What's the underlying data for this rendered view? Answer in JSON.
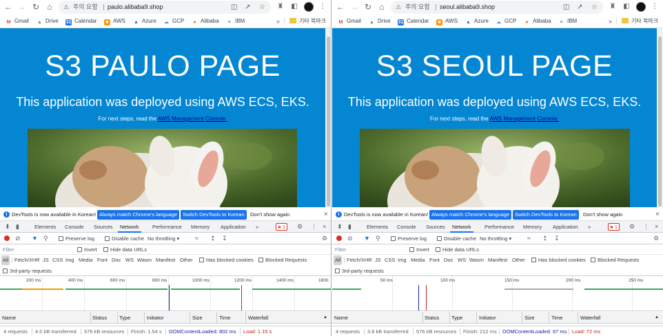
{
  "windows": [
    {
      "omnibox": {
        "security_label": "주의 요함",
        "url": "paulo.alibaba9.shop"
      },
      "page": {
        "title": "S3 PAULO PAGE",
        "subtitle": "This application was deployed using AWS ECS, EKS.",
        "next_prefix": "For next steps, read the ",
        "next_link": "AWS Management Console."
      },
      "timeline": {
        "ticks": [
          "200 ms",
          "400 ms",
          "600 ms",
          "800 ms",
          "1000 ms",
          "1200 ms",
          "1400 ms",
          "1600"
        ]
      },
      "status": {
        "requests": "4 requests",
        "transferred": "4.0 kB transferred",
        "resources": "576 kB resources",
        "finish": "Finish: 1.54 s",
        "dcl": "DOMContentLoaded: 802 ms",
        "load": "Load: 1.15 s"
      }
    },
    {
      "omnibox": {
        "security_label": "주의 요함",
        "url": "seoul.alibaba9.shop"
      },
      "page": {
        "title": "S3 SEOUL PAGE",
        "subtitle": "This application was deployed using AWS ECS, EKS.",
        "next_prefix": "For next steps, read the ",
        "next_link": "AWS Management Console."
      },
      "timeline": {
        "ticks": [
          "50 ms",
          "100 ms",
          "150 ms",
          "200 ms",
          "250 ms"
        ]
      },
      "status": {
        "requests": "4 requests",
        "transferred": "3.8 kB transferred",
        "resources": "576 kB resources",
        "finish": "Finish: 212 ms",
        "dcl": "DOMContentLoaded: 67 ms",
        "load": "Load: 72 ms"
      }
    }
  ],
  "bookmarks": [
    {
      "label": "Gmail",
      "icon": "gmail-icon",
      "color": "#ea4335"
    },
    {
      "label": "Drive",
      "icon": "drive-icon",
      "color": "#34a853"
    },
    {
      "label": "Calendar",
      "icon": "calendar-icon",
      "color": "#1a73e8"
    },
    {
      "label": "AWS",
      "icon": "aws-icon",
      "color": "#ff9900"
    },
    {
      "label": "Azure",
      "icon": "azure-icon",
      "color": "#0078d4"
    },
    {
      "label": "GCP",
      "icon": "gcp-icon",
      "color": "#4285f4"
    },
    {
      "label": "Alibaba",
      "icon": "alibaba-icon",
      "color": "#ff6a00"
    },
    {
      "label": "IBM",
      "icon": "ibm-icon",
      "color": "#1f70c1"
    }
  ],
  "bookmarks_more": "»",
  "other_bookmarks": "기타 북마크",
  "infobar": {
    "message": "DevTools is now available in Korean!",
    "btn_match": "Always match Chrome's language",
    "btn_switch": "Switch DevTools to Korean",
    "dont_show": "Don't show again"
  },
  "devtools_tabs": [
    "Elements",
    "Console",
    "Sources",
    "Network",
    "Performance",
    "Memory",
    "Application"
  ],
  "devtools_active_tab": "Network",
  "devtools_more": "»",
  "error_count": "1",
  "network_toolbar": {
    "preserve_log": "Preserve log",
    "disable_cache": "Disable cache",
    "throttling": "No throttling"
  },
  "filter": {
    "placeholder": "Filter",
    "invert": "Invert",
    "hide_data_urls": "Hide data URLs"
  },
  "types": [
    "All",
    "Fetch/XHR",
    "JS",
    "CSS",
    "Img",
    "Media",
    "Font",
    "Doc",
    "WS",
    "Wasm",
    "Manifest",
    "Other"
  ],
  "type_checks": {
    "blocked_cookies": "Has blocked cookies",
    "blocked_requests": "Blocked Requests"
  },
  "third_party": "3rd-party requests",
  "table_headers": [
    "Name",
    "Status",
    "Type",
    "Initiator",
    "Size",
    "Time",
    "Waterfall"
  ],
  "colors": {
    "page_bg": "#0486d3",
    "link": "#00008b",
    "devtools_blue": "#1a73e8",
    "dcl_line": "#1a1aa6",
    "load_line": "#c5221f"
  }
}
